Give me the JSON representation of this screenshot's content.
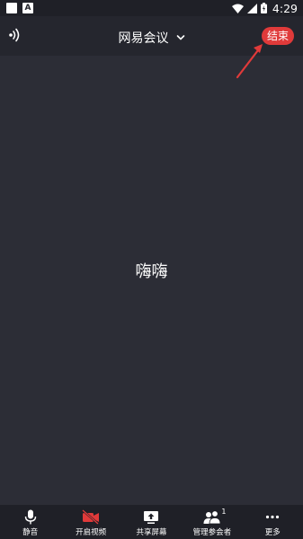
{
  "status_bar": {
    "notification_a": "A",
    "time": "4:29"
  },
  "header": {
    "title": "网易会议",
    "end_label": "结束",
    "end_color": "#e03a3a"
  },
  "main": {
    "participant_name": "嗨嗨"
  },
  "toolbar": {
    "items": [
      {
        "label": "静音",
        "icon": "microphone-icon"
      },
      {
        "label": "开启视频",
        "icon": "video-off-icon",
        "color": "#e03a3a"
      },
      {
        "label": "共享屏幕",
        "icon": "screen-share-icon"
      },
      {
        "label": "管理参会者",
        "icon": "participants-icon",
        "badge": "1"
      },
      {
        "label": "更多",
        "icon": "more-icon"
      }
    ]
  }
}
